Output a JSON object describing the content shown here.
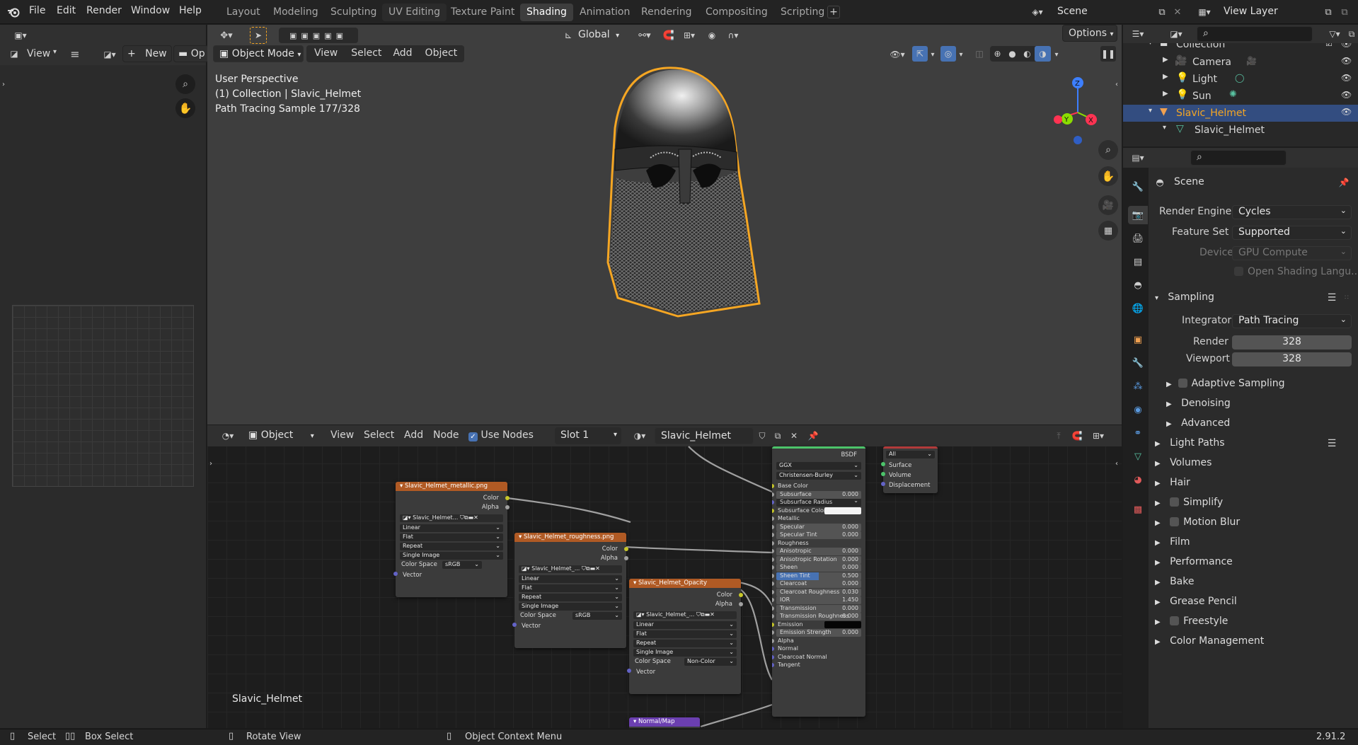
{
  "topbar": {
    "menu": [
      "File",
      "Edit",
      "Render",
      "Window",
      "Help"
    ],
    "workspaces": [
      "Layout",
      "Modeling",
      "Sculpting",
      "UV Editing",
      "Texture Paint",
      "Shading",
      "Animation",
      "Rendering",
      "Compositing",
      "Scripting"
    ],
    "active_workspace": "Shading",
    "scene": "Scene",
    "view_layer": "View Layer"
  },
  "image_editor": {
    "view_label": "View",
    "new_label": "New",
    "open_label": "Op"
  },
  "viewport": {
    "transform_orientation": "Global",
    "options_label": "Options",
    "mode": "Object Mode",
    "menus": [
      "View",
      "Select",
      "Add",
      "Object"
    ],
    "overlay_text": [
      "User Perspective",
      "(1) Collection | Slavic_Helmet",
      "Path Tracing Sample 177/328"
    ]
  },
  "node_editor": {
    "editor_type": "Object",
    "menus": [
      "View",
      "Select",
      "Add",
      "Node"
    ],
    "use_nodes_label": "Use Nodes",
    "slot": "Slot 1",
    "material": "Slavic_Helmet",
    "footer_label": "Slavic_Helmet",
    "nodes": {
      "metallic": {
        "title": "Slavic_Helmet_metallic.png",
        "outputs": [
          "Color",
          "Alpha"
        ],
        "image": "Slavic_Helmet...",
        "options": [
          "Linear",
          "Flat",
          "Repeat",
          "Single Image"
        ],
        "color_space_label": "Color Space",
        "color_space": "sRGB",
        "input": "Vector"
      },
      "roughness": {
        "title": "Slavic_Helmet_roughness.png",
        "outputs": [
          "Color",
          "Alpha"
        ],
        "image": "Slavic_Helmet_...",
        "options": [
          "Linear",
          "Flat",
          "Repeat",
          "Single Image"
        ],
        "color_space_label": "Color Space",
        "color_space": "sRGB",
        "input": "Vector"
      },
      "opacity": {
        "title": "Slavic_Helmet_Opacity",
        "outputs": [
          "Color",
          "Alpha"
        ],
        "image": "Slavic_Helmet_...",
        "options": [
          "Linear",
          "Flat",
          "Repeat",
          "Single Image"
        ],
        "color_space_label": "Color Space",
        "color_space": "Non-Color",
        "input": "Vector"
      },
      "bsdf": {
        "output": "BSDF",
        "distribution": "GGX",
        "subsurface_method": "Christensen-Burley",
        "inputs": [
          {
            "label": "Base Color",
            "value": ""
          },
          {
            "label": "Subsurface",
            "value": "0.000"
          },
          {
            "label": "Subsurface Radius",
            "value": ""
          },
          {
            "label": "Subsurface Color",
            "value": ""
          },
          {
            "label": "Metallic",
            "value": ""
          },
          {
            "label": "Specular",
            "value": "0.000"
          },
          {
            "label": "Specular Tint",
            "value": "0.000"
          },
          {
            "label": "Roughness",
            "value": ""
          },
          {
            "label": "Anisotropic",
            "value": "0.000"
          },
          {
            "label": "Anisotropic Rotation",
            "value": "0.000"
          },
          {
            "label": "Sheen",
            "value": "0.000"
          },
          {
            "label": "Sheen Tint",
            "value": "0.500"
          },
          {
            "label": "Clearcoat",
            "value": "0.000"
          },
          {
            "label": "Clearcoat Roughness",
            "value": "0.030"
          },
          {
            "label": "IOR",
            "value": "1.450"
          },
          {
            "label": "Transmission",
            "value": "0.000"
          },
          {
            "label": "Transmission Roughness",
            "value": "0.000"
          },
          {
            "label": "Emission",
            "value": ""
          },
          {
            "label": "Emission Strength",
            "value": "0.000"
          },
          {
            "label": "Alpha",
            "value": ""
          },
          {
            "label": "Normal",
            "value": ""
          },
          {
            "label": "Clearcoat Normal",
            "value": ""
          },
          {
            "label": "Tangent",
            "value": ""
          }
        ]
      },
      "output": {
        "target": "All",
        "inputs": [
          "Surface",
          "Volume",
          "Displacement"
        ]
      },
      "normalmap": {
        "title": "Normal/Map"
      }
    }
  },
  "outliner": {
    "items": [
      {
        "label": "Collection"
      },
      {
        "label": "Camera"
      },
      {
        "label": "Light"
      },
      {
        "label": "Sun"
      },
      {
        "label": "Slavic_Helmet"
      },
      {
        "label": "Slavic_Helmet"
      }
    ]
  },
  "properties": {
    "title": "Scene",
    "render_engine_label": "Render Engine",
    "render_engine": "Cycles",
    "feature_set_label": "Feature Set",
    "feature_set": "Supported",
    "device_label": "Device",
    "device": "GPU Compute",
    "open_shading": "Open Shading Langu...",
    "sampling_label": "Sampling",
    "integrator_label": "Integrator",
    "integrator": "Path Tracing",
    "render_label": "Render",
    "render_samples": "328",
    "viewport_label": "Viewport",
    "viewport_samples": "328",
    "subsections": [
      "Adaptive Sampling",
      "Denoising",
      "Advanced"
    ],
    "sections": [
      "Light Paths",
      "Volumes",
      "Hair",
      "Simplify",
      "Motion Blur",
      "Film",
      "Performance",
      "Bake",
      "Grease Pencil",
      "Freestyle",
      "Color Management"
    ]
  },
  "statusbar": {
    "select": "Select",
    "box_select": "Box Select",
    "rotate_view": "Rotate View",
    "context_menu": "Object Context Menu",
    "version": "2.91.2"
  },
  "colors": {
    "accent_blue": "#4772b3",
    "selection_orange": "#f5a623",
    "image_node_header": "#b05a24",
    "outliner_selected": "#334d80"
  }
}
